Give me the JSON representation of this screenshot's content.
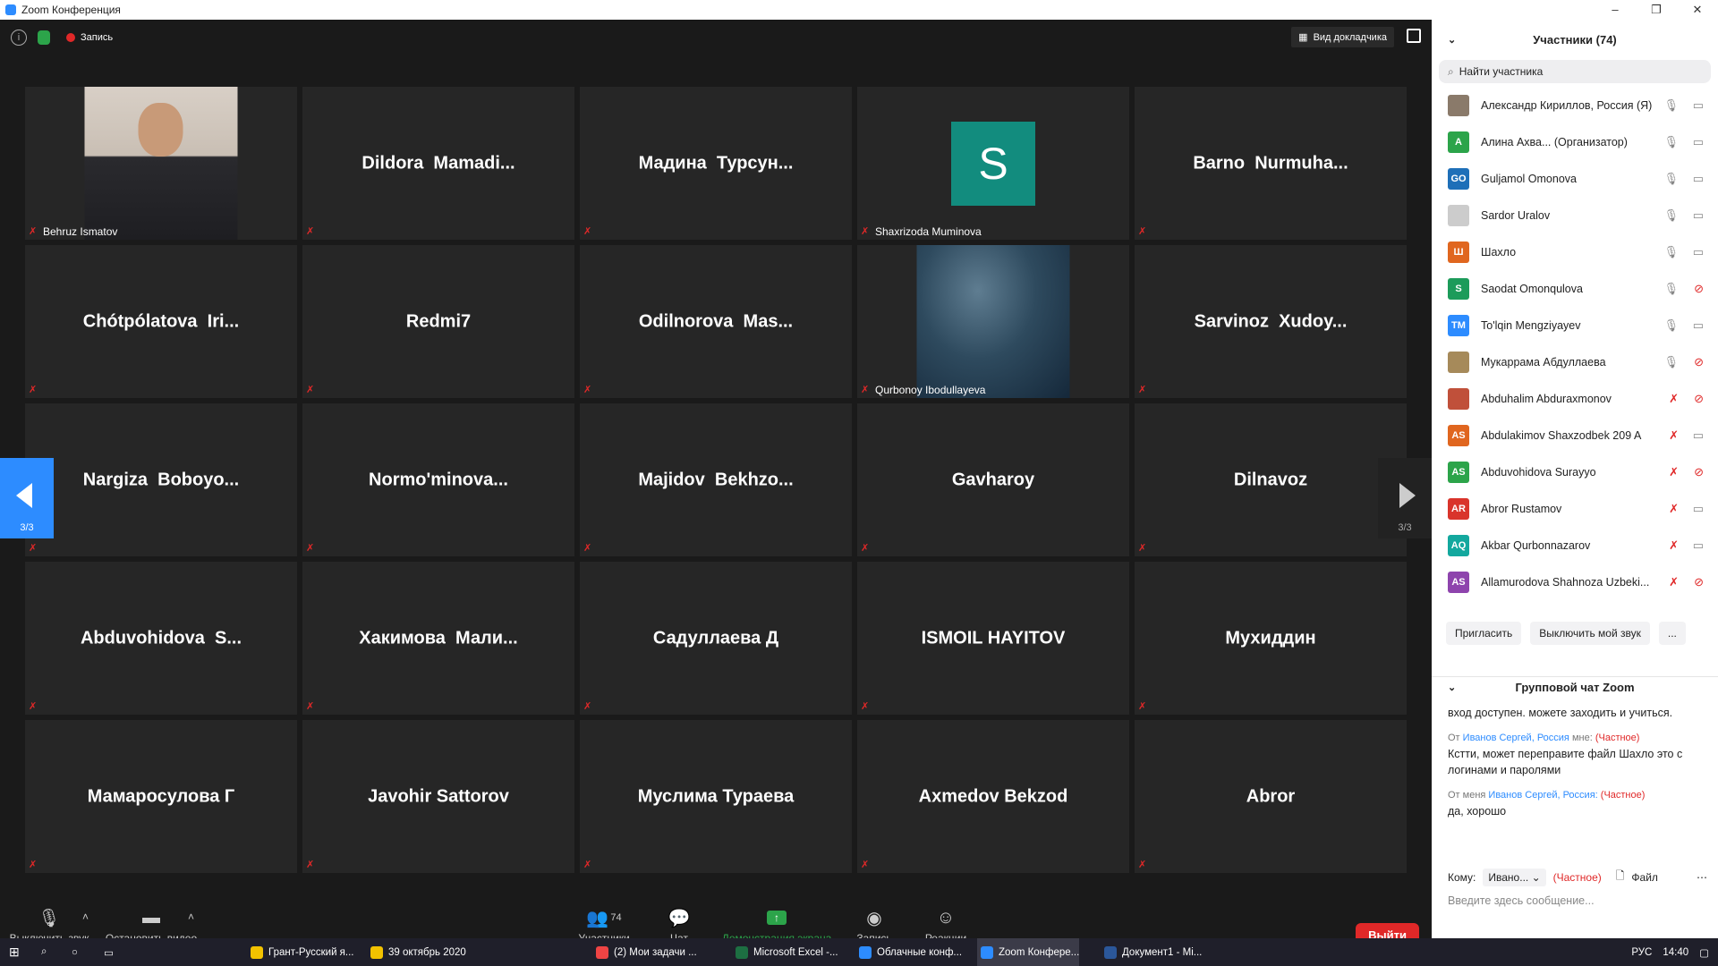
{
  "window": {
    "title": "Zoom Конференция",
    "controls": [
      "–",
      "❐",
      "✕"
    ]
  },
  "topbar": {
    "record_label": "Запись",
    "speaker_view": "Вид докладчика"
  },
  "grid": {
    "page_left": "3/3",
    "page_right": "3/3",
    "tiles": [
      {
        "name": "",
        "label": "Behruz Ismatov",
        "type": "photo"
      },
      {
        "name": "Dildora  Mamadi...",
        "label": ""
      },
      {
        "name": "Мадина  Турсун...",
        "label": ""
      },
      {
        "name": "",
        "label": "Shaxrizoda Muminova",
        "type": "avatar",
        "avatar": "S"
      },
      {
        "name": "Barno  Nurmuha...",
        "label": ""
      },
      {
        "name": "Chótpólatova  Iri...",
        "label": ""
      },
      {
        "name": "Redmi7",
        "label": ""
      },
      {
        "name": "Odilnorova  Mas...",
        "label": ""
      },
      {
        "name": "",
        "label": "Qurbonoy Ibodullayeva",
        "type": "sea"
      },
      {
        "name": "Sarvinoz  Xudoy...",
        "label": ""
      },
      {
        "name": "Nargiza  Boboyo...",
        "label": ""
      },
      {
        "name": "Normo'minova...",
        "label": ""
      },
      {
        "name": "Majidov  Bekhzo...",
        "label": ""
      },
      {
        "name": "Gavharoy",
        "label": ""
      },
      {
        "name": "Dilnavoz",
        "label": ""
      },
      {
        "name": "Abduvohidova  S...",
        "label": ""
      },
      {
        "name": "Хакимова  Мали...",
        "label": ""
      },
      {
        "name": "Садуллаева Д",
        "label": ""
      },
      {
        "name": "ISMOIL HAYITOV",
        "label": ""
      },
      {
        "name": "Мухиддин",
        "label": ""
      },
      {
        "name": "Мамаросулова Г",
        "label": ""
      },
      {
        "name": "Javohir Sattorov",
        "label": ""
      },
      {
        "name": "Муслима Тураева",
        "label": ""
      },
      {
        "name": "Axmedov Bekzod",
        "label": ""
      },
      {
        "name": "Abror",
        "label": ""
      }
    ]
  },
  "bottombar": {
    "mute": "Выключить звук",
    "video": "Остановить видео",
    "participants": "Участники",
    "participants_count": "74",
    "chat": "Чат",
    "share": "Демонстрация экрана",
    "record": "Запись",
    "reactions": "Реакции",
    "leave": "Выйти"
  },
  "panel": {
    "title": "Участники (74)",
    "search_placeholder": "Найти участника",
    "participants": [
      {
        "name": "Александр Кириллов, Россия (Я)",
        "initials": "",
        "color": "#8a7a6a",
        "mic_muted": false,
        "cam_off": false
      },
      {
        "name": "Алина Ахва...  (Организатор)",
        "initials": "A",
        "color": "#2ca44a",
        "mic_muted": false,
        "cam_off": false
      },
      {
        "name": "Guljamol Omonova",
        "initials": "GO",
        "color": "#1e6fb8",
        "mic_muted": false,
        "cam_off": false
      },
      {
        "name": "Sardor Uralov",
        "initials": "",
        "color": "#cccccc",
        "mic_muted": false,
        "cam_off": false
      },
      {
        "name": "Шахло",
        "initials": "Ш",
        "color": "#e0661f",
        "mic_muted": false,
        "cam_off": false
      },
      {
        "name": "Saodat Omonqulova",
        "initials": "S",
        "color": "#1c9b5a",
        "mic_muted": false,
        "cam_off": true
      },
      {
        "name": "To'lqin Mengziyayev",
        "initials": "TM",
        "color": "#2d8cff",
        "mic_muted": false,
        "cam_off": false
      },
      {
        "name": "Мукаррама Абдуллаева",
        "initials": "",
        "color": "#a68a5a",
        "mic_muted": false,
        "cam_off": true
      },
      {
        "name": "Abduhalim Abduraxmonov",
        "initials": "",
        "color": "#c0503a",
        "mic_muted": true,
        "cam_off": true
      },
      {
        "name": "Abdulakimov Shaxzodbek 209 A",
        "initials": "AS",
        "color": "#e0661f",
        "mic_muted": true,
        "cam_off": false
      },
      {
        "name": "Abduvohidova Surayyo",
        "initials": "AS",
        "color": "#2ca44a",
        "mic_muted": true,
        "cam_off": true
      },
      {
        "name": "Abror Rustamov",
        "initials": "AR",
        "color": "#d9342b",
        "mic_muted": true,
        "cam_off": false
      },
      {
        "name": "Akbar Qurbonnazarov",
        "initials": "AQ",
        "color": "#13a89e",
        "mic_muted": true,
        "cam_off": false
      },
      {
        "name": "Allamurodova Shahnoza Uzbeki...",
        "initials": "AS",
        "color": "#8e44ad",
        "mic_muted": true,
        "cam_off": true
      }
    ],
    "invite": "Пригласить",
    "mute_me": "Выключить мой звук",
    "more": "...",
    "chat_title": "Групповой чат Zoom",
    "chat": {
      "msg1": "вход доступен. можете заходить и учиться.",
      "m2_from": "От ",
      "m2_sender": "Иванов Сергей, Россия",
      "m2_to": " мне: ",
      "m2_priv": "(Частное)",
      "msg2": "Кстти, может переправите файл Шахло это с логинами и паролями",
      "m3_from": "От меня ",
      "m3_sender": "Иванов Сергей, Россия:",
      "m3_priv": " (Частное)",
      "msg3": "да, хорошо",
      "to_label": "Кому:",
      "to_value": "Ивано... ⌄",
      "to_priv": "(Частное)",
      "file": "Файл",
      "input_placeholder": "Введите здесь сообщение..."
    }
  },
  "taskbar": {
    "items": [
      "Грант-Русский я...",
      "39 октябрь 2020",
      "(2) Мои задачи ...",
      "Microsoft Excel -...",
      "Облачные конф...",
      "Zoom Конфере...",
      "Документ1 - Mi..."
    ],
    "lang": "РУС",
    "time": "14:40"
  }
}
